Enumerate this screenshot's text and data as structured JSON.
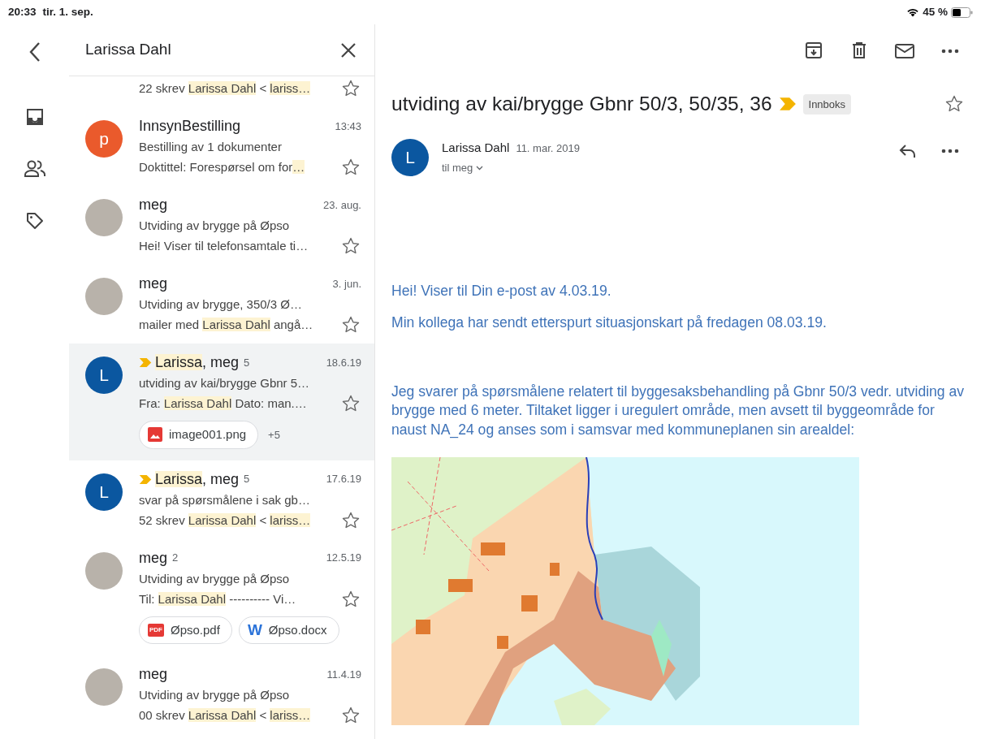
{
  "status_bar": {
    "time": "20:33",
    "date": "tir. 1. sep.",
    "battery": "45 %"
  },
  "search": {
    "query": "Larissa Dahl"
  },
  "messages": [
    {
      "snippet": [
        {
          "text": "22 skrev ",
          "highlighted": false
        },
        {
          "text": "Larissa Dahl",
          "highlighted": true
        },
        {
          "text": " < ",
          "highlighted": false
        },
        {
          "text": "lariss…",
          "highlighted": true
        }
      ],
      "starred": false,
      "selected": false
    },
    {
      "avatar": {
        "kind": "letter",
        "letter": "p",
        "color": "#ea5a2c"
      },
      "important": false,
      "sender": [
        {
          "text": "InnsynBestilling",
          "highlighted": false
        }
      ],
      "date": "13:43",
      "subject": "Bestilling av 1 dokumenter",
      "snippet": [
        {
          "text": "Doktittel: Forespørsel om for",
          "highlighted": false
        },
        {
          "text": "…",
          "highlighted": true
        }
      ],
      "starred": false,
      "selected": false
    },
    {
      "avatar": {
        "kind": "photo"
      },
      "important": false,
      "sender": [
        {
          "text": "meg",
          "highlighted": false
        }
      ],
      "date": "23. aug.",
      "subject": "Utviding av brygge på Øpso",
      "snippet": [
        {
          "text": "Hei! Viser til telefonsamtale ti…",
          "highlighted": false
        }
      ],
      "starred": false,
      "selected": false
    },
    {
      "avatar": {
        "kind": "photo"
      },
      "important": false,
      "sender": [
        {
          "text": "meg",
          "highlighted": false
        }
      ],
      "date": "3. jun.",
      "subject": "Utviding av brygge, 350/3 Ø…",
      "snippet": [
        {
          "text": "mailer med ",
          "highlighted": false
        },
        {
          "text": "Larissa Dahl",
          "highlighted": true
        },
        {
          "text": " angå…",
          "highlighted": false
        }
      ],
      "starred": false,
      "selected": false
    },
    {
      "avatar": {
        "kind": "letter",
        "letter": "L",
        "color": "#0b57a0"
      },
      "important": true,
      "sender": [
        {
          "text": "Larissa",
          "highlighted": true
        },
        {
          "text": ", meg",
          "highlighted": false
        }
      ],
      "count": "5",
      "date": "18.6.19",
      "subject": "utviding av kai/brygge Gbnr 5…",
      "snippet": [
        {
          "text": "Fra: ",
          "highlighted": false
        },
        {
          "text": "Larissa Dahl",
          "highlighted": true
        },
        {
          "text": " Dato: man.…",
          "highlighted": false
        }
      ],
      "starred": false,
      "selected": true,
      "attachments": [
        {
          "kind": "image",
          "name": "image001.png"
        }
      ],
      "more_attachments": "+5"
    },
    {
      "avatar": {
        "kind": "letter",
        "letter": "L",
        "color": "#0b57a0"
      },
      "important": true,
      "sender": [
        {
          "text": "Larissa",
          "highlighted": true
        },
        {
          "text": ", meg",
          "highlighted": false
        }
      ],
      "count": "5",
      "date": "17.6.19",
      "subject": "svar på spørsmålene i sak gb…",
      "snippet": [
        {
          "text": "52 skrev ",
          "highlighted": false
        },
        {
          "text": "Larissa Dahl",
          "highlighted": true
        },
        {
          "text": " < ",
          "highlighted": false
        },
        {
          "text": "lariss…",
          "highlighted": true
        }
      ],
      "starred": false,
      "selected": false
    },
    {
      "avatar": {
        "kind": "photo"
      },
      "important": false,
      "sender": [
        {
          "text": "meg",
          "highlighted": false
        }
      ],
      "count": "2",
      "date": "12.5.19",
      "subject": "Utviding av brygge på Øpso",
      "snippet": [
        {
          "text": "Til: ",
          "highlighted": false
        },
        {
          "text": "Larissa Dahl",
          "highlighted": true
        },
        {
          "text": " ---------- Vi…",
          "highlighted": false
        }
      ],
      "starred": false,
      "selected": false,
      "attachments": [
        {
          "kind": "pdf",
          "badge": "PDF",
          "name": "Øpso.pdf"
        },
        {
          "kind": "word",
          "badge": "W",
          "name": "Øpso.docx"
        }
      ]
    },
    {
      "avatar": {
        "kind": "photo"
      },
      "important": false,
      "sender": [
        {
          "text": "meg",
          "highlighted": false
        }
      ],
      "date": "11.4.19",
      "subject": "Utviding av brygge på Øpso",
      "snippet": [
        {
          "text": "00 skrev ",
          "highlighted": false
        },
        {
          "text": "Larissa Dahl",
          "highlighted": true
        },
        {
          "text": " < ",
          "highlighted": false
        },
        {
          "text": "lariss…",
          "highlighted": true
        }
      ],
      "starred": false,
      "selected": false
    }
  ],
  "detail": {
    "subject": "utviding av kai/brygge Gbnr 50/3, 50/35, 36",
    "important": true,
    "label": "Innboks",
    "starred": false,
    "avatar": {
      "letter": "L",
      "color": "#0b57a0"
    },
    "sender": "Larissa Dahl",
    "date": "11. mar. 2019",
    "recipient": "til meg",
    "body": [
      "Hei! Viser til Din e-post av 4.03.19.",
      "Min kollega har sendt etterspurt situasjonskart på fredagen 08.03.19.",
      "Jeg svarer på spørsmålene relatert til byggesaksbehandling på Gbnr 50/3 vedr. utviding av brygge med 6 meter. Tiltaket ligger i uregulert område, men avsett til byggeområde for naust NA_24 og anses som i samsvar med kommuneplanen sin arealdel:"
    ]
  }
}
